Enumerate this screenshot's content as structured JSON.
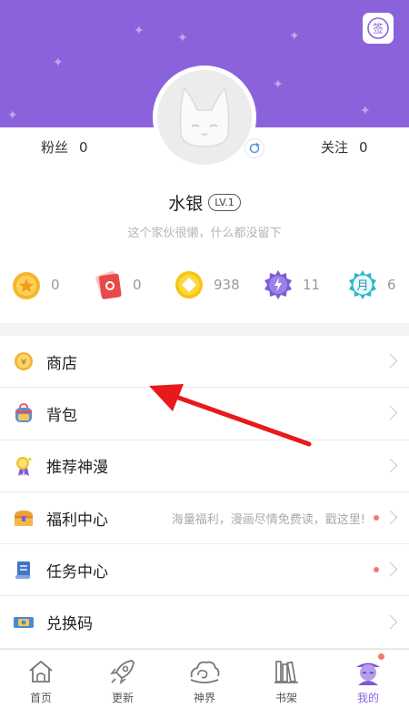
{
  "header": {
    "bg_color": "#8a63dc",
    "checkin_icon": "sign-in-stamp-icon",
    "checkin_glyph": "签"
  },
  "profile": {
    "fans_label": "粉丝",
    "fans_count": "0",
    "follow_label": "关注",
    "follow_count": "0",
    "username": "水银",
    "level": "LV.1",
    "bio": "这个家伙很懒，什么都没留下",
    "moon_glyph": "月"
  },
  "currencies": [
    {
      "icon": "gold-coin-icon",
      "value": "0"
    },
    {
      "icon": "red-ticket-icon",
      "value": "0"
    },
    {
      "icon": "diamond-coin-icon",
      "value": "938"
    },
    {
      "icon": "purple-gear-badge-icon",
      "value": "11"
    },
    {
      "icon": "monthly-ticket-icon",
      "value": "6"
    }
  ],
  "menu": [
    {
      "label": "商店",
      "icon": "shop-coin-icon"
    },
    {
      "label": "背包",
      "icon": "backpack-icon"
    },
    {
      "label": "推荐神漫",
      "icon": "recommend-medal-icon"
    },
    {
      "label": "福利中心",
      "icon": "treasure-chest-icon",
      "hint": "海量福利，漫画尽情免费读，戳这里!"
    },
    {
      "label": "任务中心",
      "icon": "task-scroll-icon"
    },
    {
      "label": "兑换码",
      "icon": "redeem-code-icon"
    }
  ],
  "tabs": [
    {
      "label": "首页",
      "icon": "home-icon"
    },
    {
      "label": "更新",
      "icon": "rocket-icon"
    },
    {
      "label": "神界",
      "icon": "cloud-swirl-icon"
    },
    {
      "label": "书架",
      "icon": "bookshelf-icon"
    },
    {
      "label": "我的",
      "icon": "profile-avatar-icon",
      "active": true
    }
  ],
  "colors": {
    "accent": "#8a63dc",
    "annotation_arrow": "#e8191a",
    "notification_dot": "#f07a6c"
  }
}
